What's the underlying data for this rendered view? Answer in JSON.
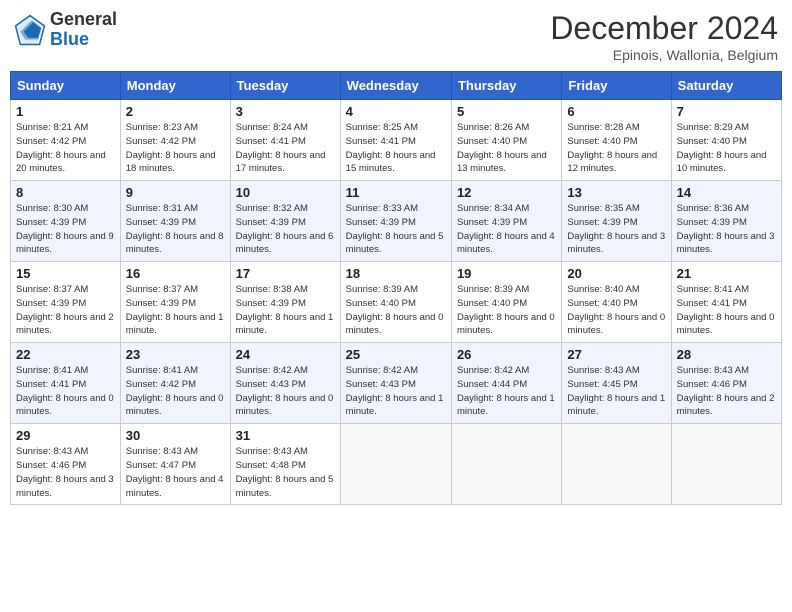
{
  "header": {
    "logo_general": "General",
    "logo_blue": "Blue",
    "month_title": "December 2024",
    "location": "Epinois, Wallonia, Belgium"
  },
  "days_of_week": [
    "Sunday",
    "Monday",
    "Tuesday",
    "Wednesday",
    "Thursday",
    "Friday",
    "Saturday"
  ],
  "weeks": [
    [
      {
        "day": 1,
        "sunrise": "8:21 AM",
        "sunset": "4:42 PM",
        "daylight": "8 hours and 20 minutes."
      },
      {
        "day": 2,
        "sunrise": "8:23 AM",
        "sunset": "4:42 PM",
        "daylight": "8 hours and 18 minutes."
      },
      {
        "day": 3,
        "sunrise": "8:24 AM",
        "sunset": "4:41 PM",
        "daylight": "8 hours and 17 minutes."
      },
      {
        "day": 4,
        "sunrise": "8:25 AM",
        "sunset": "4:41 PM",
        "daylight": "8 hours and 15 minutes."
      },
      {
        "day": 5,
        "sunrise": "8:26 AM",
        "sunset": "4:40 PM",
        "daylight": "8 hours and 13 minutes."
      },
      {
        "day": 6,
        "sunrise": "8:28 AM",
        "sunset": "4:40 PM",
        "daylight": "8 hours and 12 minutes."
      },
      {
        "day": 7,
        "sunrise": "8:29 AM",
        "sunset": "4:40 PM",
        "daylight": "8 hours and 10 minutes."
      }
    ],
    [
      {
        "day": 8,
        "sunrise": "8:30 AM",
        "sunset": "4:39 PM",
        "daylight": "8 hours and 9 minutes."
      },
      {
        "day": 9,
        "sunrise": "8:31 AM",
        "sunset": "4:39 PM",
        "daylight": "8 hours and 8 minutes."
      },
      {
        "day": 10,
        "sunrise": "8:32 AM",
        "sunset": "4:39 PM",
        "daylight": "8 hours and 6 minutes."
      },
      {
        "day": 11,
        "sunrise": "8:33 AM",
        "sunset": "4:39 PM",
        "daylight": "8 hours and 5 minutes."
      },
      {
        "day": 12,
        "sunrise": "8:34 AM",
        "sunset": "4:39 PM",
        "daylight": "8 hours and 4 minutes."
      },
      {
        "day": 13,
        "sunrise": "8:35 AM",
        "sunset": "4:39 PM",
        "daylight": "8 hours and 3 minutes."
      },
      {
        "day": 14,
        "sunrise": "8:36 AM",
        "sunset": "4:39 PM",
        "daylight": "8 hours and 3 minutes."
      }
    ],
    [
      {
        "day": 15,
        "sunrise": "8:37 AM",
        "sunset": "4:39 PM",
        "daylight": "8 hours and 2 minutes."
      },
      {
        "day": 16,
        "sunrise": "8:37 AM",
        "sunset": "4:39 PM",
        "daylight": "8 hours and 1 minute."
      },
      {
        "day": 17,
        "sunrise": "8:38 AM",
        "sunset": "4:39 PM",
        "daylight": "8 hours and 1 minute."
      },
      {
        "day": 18,
        "sunrise": "8:39 AM",
        "sunset": "4:40 PM",
        "daylight": "8 hours and 0 minutes."
      },
      {
        "day": 19,
        "sunrise": "8:39 AM",
        "sunset": "4:40 PM",
        "daylight": "8 hours and 0 minutes."
      },
      {
        "day": 20,
        "sunrise": "8:40 AM",
        "sunset": "4:40 PM",
        "daylight": "8 hours and 0 minutes."
      },
      {
        "day": 21,
        "sunrise": "8:41 AM",
        "sunset": "4:41 PM",
        "daylight": "8 hours and 0 minutes."
      }
    ],
    [
      {
        "day": 22,
        "sunrise": "8:41 AM",
        "sunset": "4:41 PM",
        "daylight": "8 hours and 0 minutes."
      },
      {
        "day": 23,
        "sunrise": "8:41 AM",
        "sunset": "4:42 PM",
        "daylight": "8 hours and 0 minutes."
      },
      {
        "day": 24,
        "sunrise": "8:42 AM",
        "sunset": "4:43 PM",
        "daylight": "8 hours and 0 minutes."
      },
      {
        "day": 25,
        "sunrise": "8:42 AM",
        "sunset": "4:43 PM",
        "daylight": "8 hours and 1 minute."
      },
      {
        "day": 26,
        "sunrise": "8:42 AM",
        "sunset": "4:44 PM",
        "daylight": "8 hours and 1 minute."
      },
      {
        "day": 27,
        "sunrise": "8:43 AM",
        "sunset": "4:45 PM",
        "daylight": "8 hours and 1 minute."
      },
      {
        "day": 28,
        "sunrise": "8:43 AM",
        "sunset": "4:46 PM",
        "daylight": "8 hours and 2 minutes."
      }
    ],
    [
      {
        "day": 29,
        "sunrise": "8:43 AM",
        "sunset": "4:46 PM",
        "daylight": "8 hours and 3 minutes."
      },
      {
        "day": 30,
        "sunrise": "8:43 AM",
        "sunset": "4:47 PM",
        "daylight": "8 hours and 4 minutes."
      },
      {
        "day": 31,
        "sunrise": "8:43 AM",
        "sunset": "4:48 PM",
        "daylight": "8 hours and 5 minutes."
      },
      null,
      null,
      null,
      null
    ]
  ]
}
